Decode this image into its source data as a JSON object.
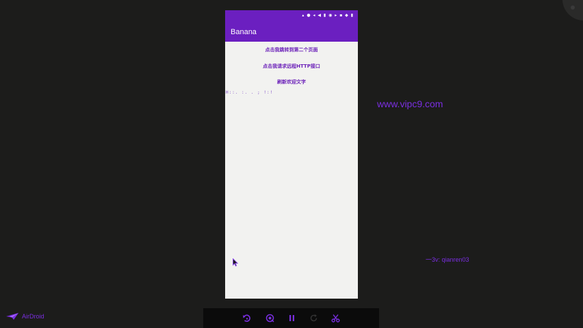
{
  "phone": {
    "status_icons": "▴ ● ◂ ◀ ▮ ◉ ▸ ▪ ◆ ▮",
    "app_title": "Banana",
    "buttons": [
      "点击我跳转到第二个页面",
      "点击我请求远程HTTP接口",
      "刷新欢迎文字"
    ],
    "result_text": "H::. :. . ; !:!"
  },
  "watermark": {
    "url": "www.vipc9.com",
    "contact": "一3v: qianren03"
  },
  "brand": {
    "name": "AirDroid"
  },
  "controls": [
    "rotate-left-icon",
    "screen-record-icon",
    "pause-icon",
    "refresh-icon",
    "scissors-icon"
  ],
  "colors": {
    "accent": "#6b1fc0",
    "watermark": "#7a2ee0",
    "background": "#1c1c1b"
  }
}
